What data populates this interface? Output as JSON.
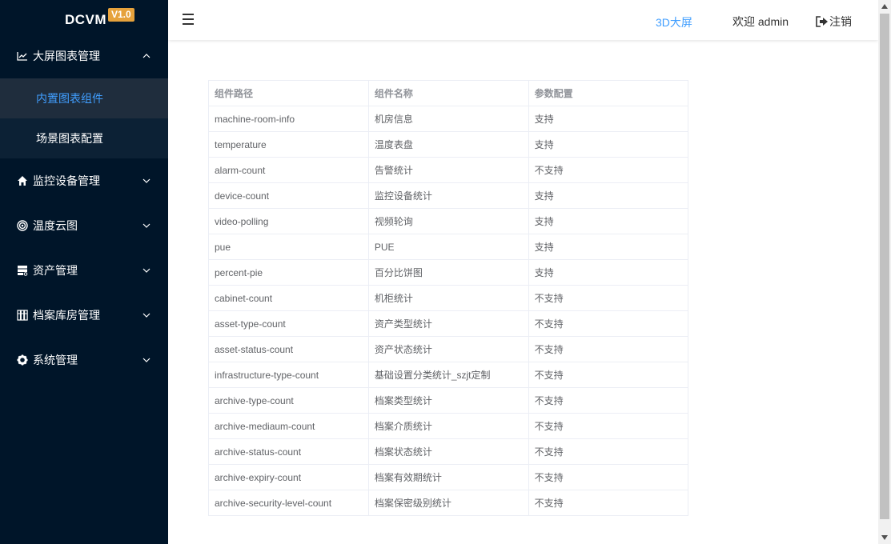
{
  "logo": {
    "text": "DCVM",
    "version": "V1.0"
  },
  "sidebar": {
    "groups": [
      {
        "label": "大屏图表管理",
        "icon": "line-chart-icon",
        "expanded": true,
        "children": [
          {
            "label": "内置图表组件",
            "active": true
          },
          {
            "label": "场景图表配置",
            "active": false
          }
        ]
      },
      {
        "label": "监控设备管理",
        "icon": "home-icon",
        "expanded": false
      },
      {
        "label": "温度云图",
        "icon": "target-icon",
        "expanded": false
      },
      {
        "label": "资产管理",
        "icon": "server-icon",
        "expanded": false
      },
      {
        "label": "档案库房管理",
        "icon": "archive-icon",
        "expanded": false
      },
      {
        "label": "系统管理",
        "icon": "gear-icon",
        "expanded": false
      }
    ]
  },
  "header": {
    "link_3d": "3D大屏",
    "welcome": "欢迎 admin",
    "logout": "注销"
  },
  "table": {
    "headers": [
      "组件路径",
      "组件名称",
      "参数配置"
    ],
    "rows": [
      [
        "machine-room-info",
        "机房信息",
        "支持"
      ],
      [
        "temperature",
        "温度表盘",
        "支持"
      ],
      [
        "alarm-count",
        "告警统计",
        "不支持"
      ],
      [
        "device-count",
        "监控设备统计",
        "支持"
      ],
      [
        "video-polling",
        "视频轮询",
        "支持"
      ],
      [
        "pue",
        "PUE",
        "支持"
      ],
      [
        "percent-pie",
        "百分比饼图",
        "支持"
      ],
      [
        "cabinet-count",
        "机柜统计",
        "不支持"
      ],
      [
        "asset-type-count",
        "资产类型统计",
        "不支持"
      ],
      [
        "asset-status-count",
        "资产状态统计",
        "不支持"
      ],
      [
        "infrastructure-type-count",
        "基础设置分类统计_szjt定制",
        "不支持"
      ],
      [
        "archive-type-count",
        "档案类型统计",
        "不支持"
      ],
      [
        "archive-mediaum-count",
        "档案介质统计",
        "不支持"
      ],
      [
        "archive-status-count",
        "档案状态统计",
        "不支持"
      ],
      [
        "archive-expiry-count",
        "档案有效期统计",
        "不支持"
      ],
      [
        "archive-security-level-count",
        "档案保密级别统计",
        "不支持"
      ]
    ]
  },
  "colors": {
    "sidebar_bg": "#001529",
    "submenu_bg": "#0c2135",
    "active_text": "#409eff",
    "version_badge": "#e6a23c"
  }
}
